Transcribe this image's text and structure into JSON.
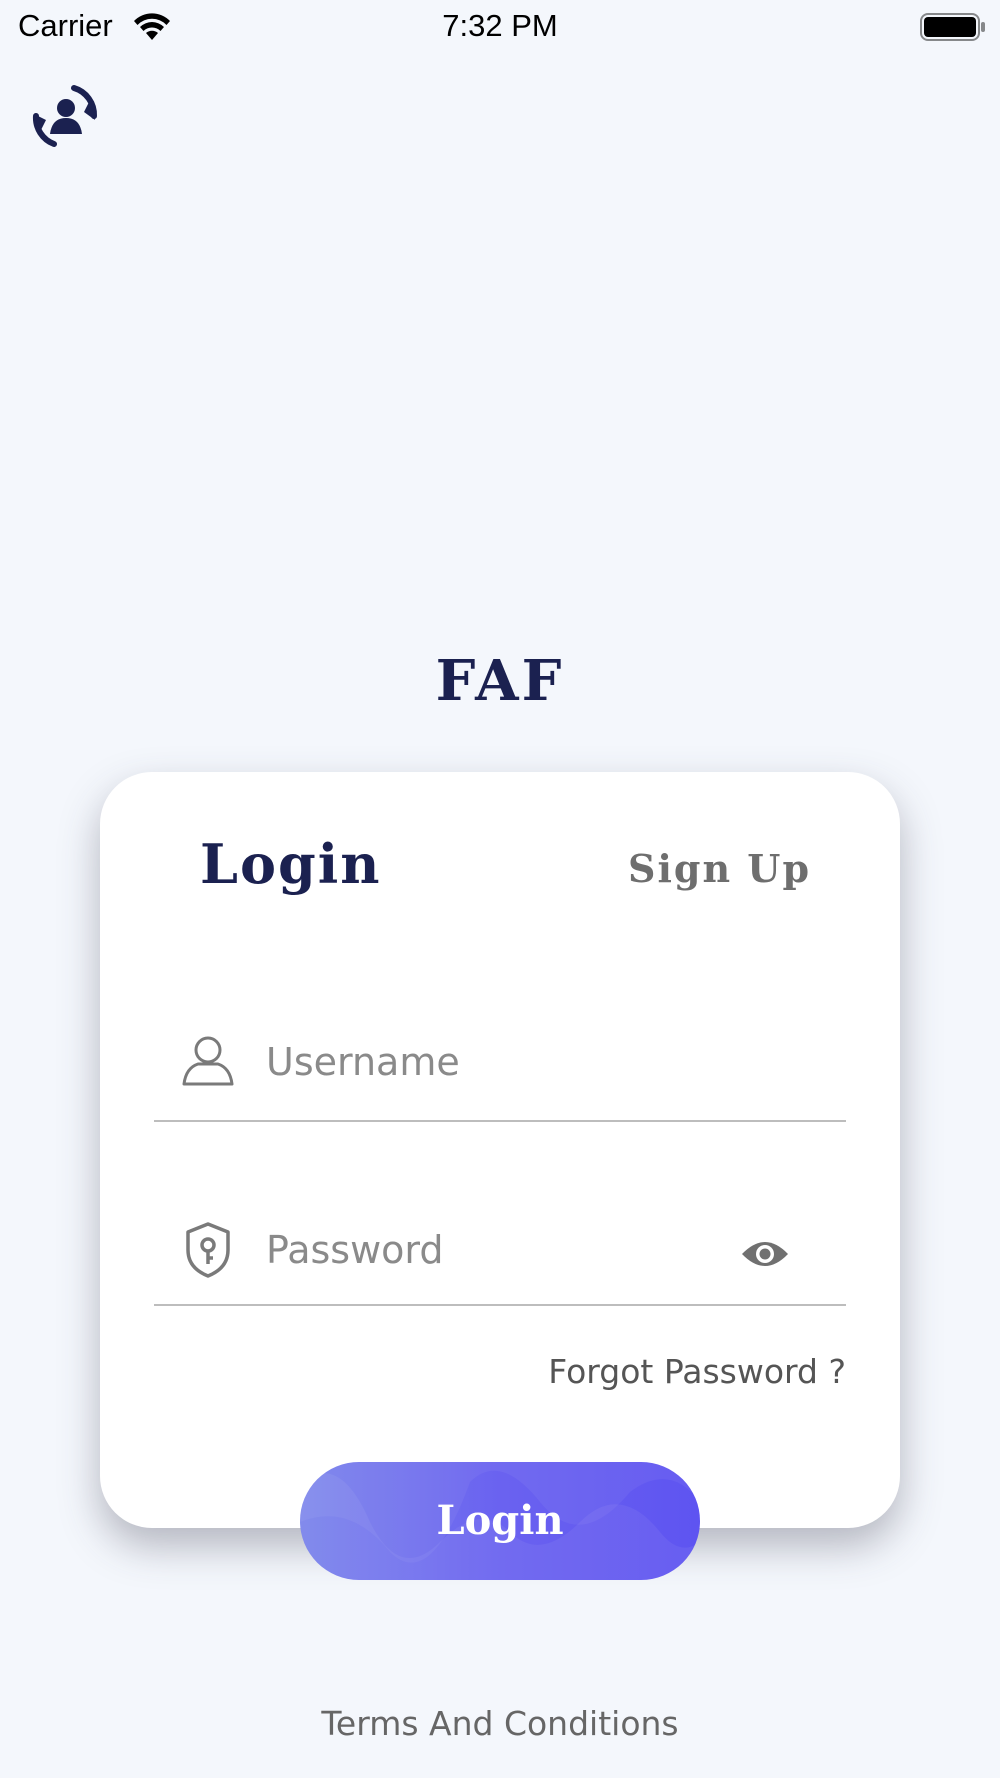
{
  "status_bar": {
    "carrier": "Carrier",
    "time": "7:32 PM",
    "wifi_icon": "wifi-icon",
    "battery_icon": "battery-full-icon"
  },
  "header": {
    "logo_icon": "person-sync-icon"
  },
  "brand": {
    "title": "FAF"
  },
  "card": {
    "tabs": {
      "login": "Login",
      "signup": "Sign Up"
    },
    "username": {
      "placeholder": "Username",
      "value": "",
      "icon": "user-icon"
    },
    "password": {
      "placeholder": "Password",
      "value": "",
      "icon": "shield-key-icon",
      "toggle_icon": "eye-icon"
    },
    "forgot_password": "Forgot Password ?"
  },
  "login_button": {
    "label": "Login"
  },
  "footer": {
    "terms": "Terms And Conditions"
  },
  "colors": {
    "background": "#f4f7fc",
    "primary_text": "#1b2150",
    "button_gradient_start": "#7b84eb",
    "button_gradient_end": "#5e54f1"
  }
}
